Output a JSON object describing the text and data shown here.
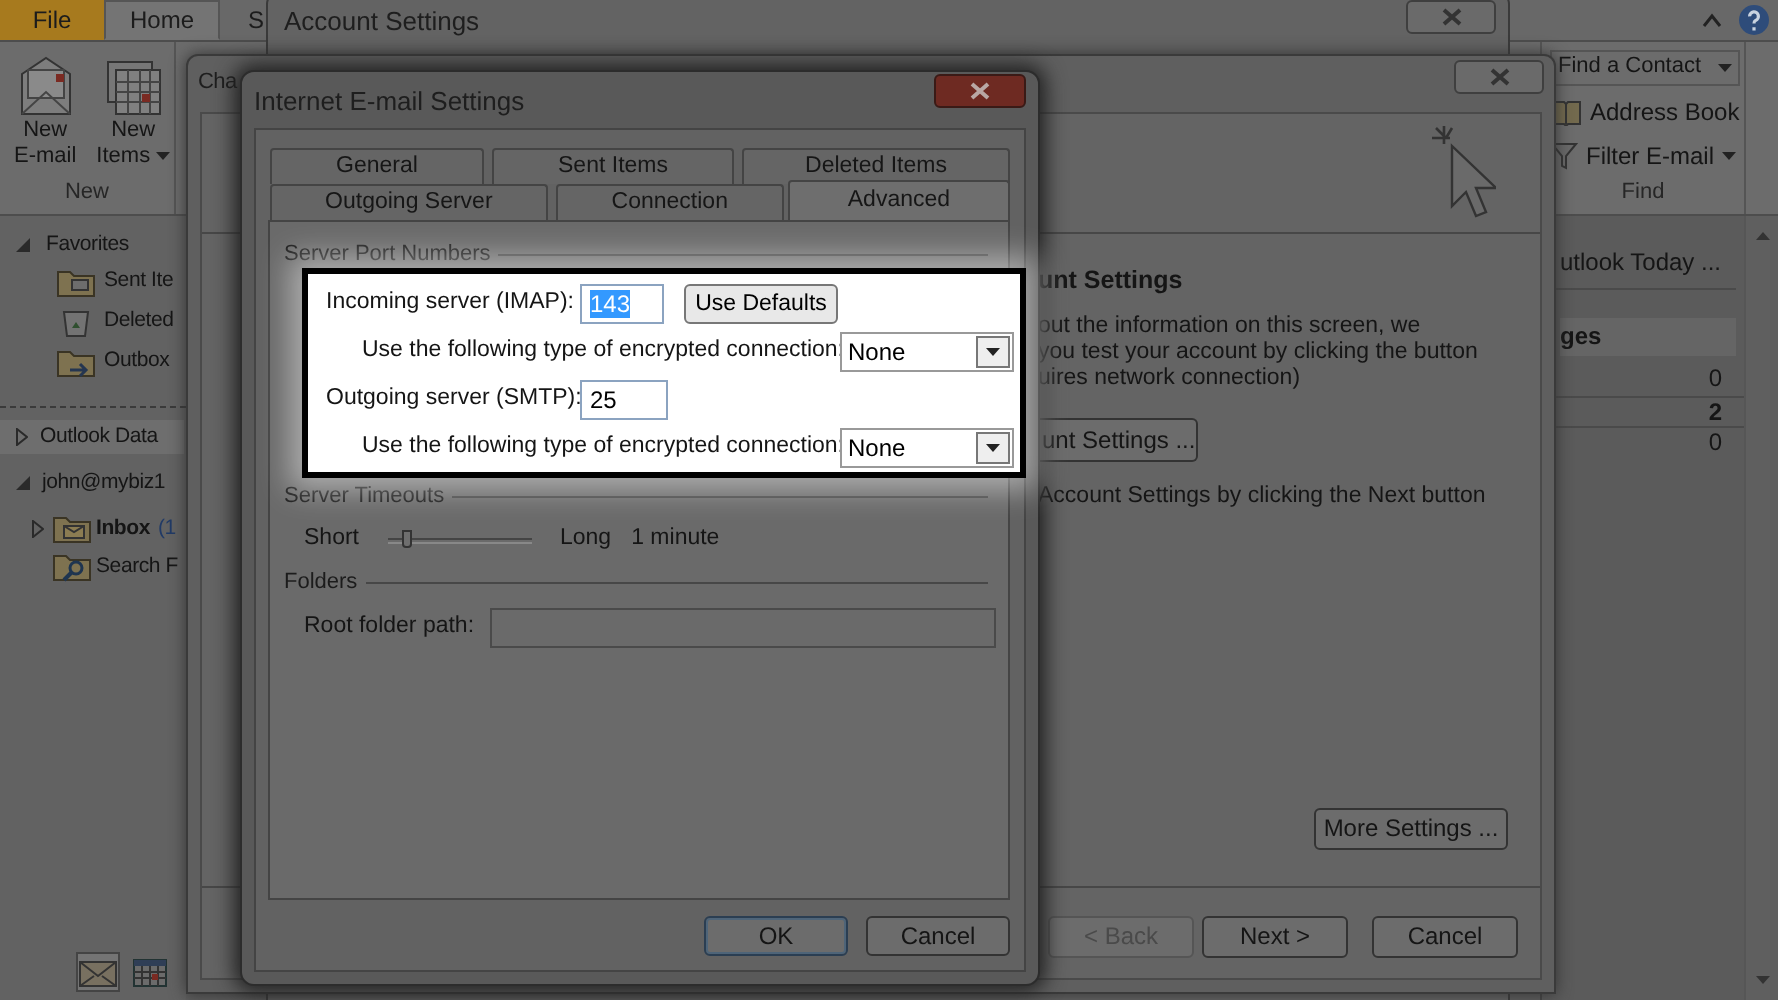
{
  "outlook": {
    "ribbon_tabs": [
      {
        "label": "File",
        "kind": "file",
        "selected": false
      },
      {
        "label": "Home",
        "kind": "tab",
        "selected": true
      },
      {
        "label": "S",
        "kind": "tab",
        "selected": false
      }
    ],
    "new_group": {
      "title": "New",
      "buttons": [
        {
          "label": "New E-mail",
          "kind": "mail",
          "dropdown": false
        },
        {
          "label": "New Items",
          "kind": "items",
          "dropdown": true
        }
      ]
    },
    "find_group": {
      "title": "Find",
      "items": [
        {
          "label": "Find a Contact",
          "kind": "search-box",
          "dropdown": true
        },
        {
          "label": "Address Book",
          "kind": "book",
          "dropdown": false
        },
        {
          "label": "Filter E-mail",
          "kind": "filter",
          "dropdown": true
        }
      ]
    },
    "navigation": {
      "favorites": {
        "label": "Favorites",
        "expanded": true,
        "children": [
          {
            "label": "Sent Ite",
            "kind": "sent"
          },
          {
            "label": "Deleted",
            "kind": "deleted"
          },
          {
            "label": "Outbox",
            "kind": "outbox"
          }
        ]
      },
      "accounts": [
        {
          "label": "Outlook Data",
          "expanded": false,
          "selected": true
        },
        {
          "label": "john@mybiz1",
          "expanded": true,
          "selected": false,
          "children": [
            {
              "label": "Inbox",
              "count": "(1",
              "kind": "inbox",
              "unread": true
            },
            {
              "label": "Search F",
              "kind": "search",
              "unread": false
            }
          ]
        }
      ],
      "bottom_icons": [
        {
          "kind": "mail",
          "selected": true
        },
        {
          "kind": "calendar",
          "selected": false
        }
      ]
    },
    "todo_bar": {
      "link": "utlook Today ...",
      "header": "ges",
      "counts": [
        {
          "value": "0",
          "bold": false
        },
        {
          "value": "2",
          "bold": true
        },
        {
          "value": "0",
          "bold": false
        }
      ]
    }
  },
  "account_settings": {
    "title": "Account Settings"
  },
  "change_account": {
    "title": "Cha",
    "heading": "unt Settings",
    "description": [
      "out the information on this screen, we",
      "you test your account by clicking the button",
      "uires network connection)"
    ],
    "test_button": "unt Settings ...",
    "next_hint": "Account Settings by clicking the Next button",
    "more_settings": "More Settings ...",
    "buttons": [
      {
        "label": "< Back",
        "disabled": true
      },
      {
        "label": "Next >",
        "disabled": false
      },
      {
        "label": "Cancel",
        "disabled": false
      }
    ]
  },
  "email_settings": {
    "title": "Internet E-mail Settings",
    "tab_rows": [
      [
        {
          "label": "General",
          "selected": false
        },
        {
          "label": "Sent Items",
          "selected": false
        },
        {
          "label": "Deleted Items",
          "selected": false
        }
      ],
      [
        {
          "label": "Outgoing Server",
          "selected": false
        },
        {
          "label": "Connection",
          "selected": false
        },
        {
          "label": "Advanced",
          "selected": true
        }
      ]
    ],
    "server_ports": {
      "title": "Server Port Numbers",
      "highlighted": true,
      "incoming": {
        "label": "Incoming server (IMAP):",
        "value": "143",
        "text_selected": true
      },
      "use_defaults": "Use Defaults",
      "incoming_encryption": {
        "label": "Use the following type of encrypted connection:",
        "value": "None"
      },
      "outgoing": {
        "label": "Outgoing server (SMTP):",
        "value": "25",
        "text_selected": false
      },
      "outgoing_encryption": {
        "label": "Use the following type of encrypted connection:",
        "value": "None"
      }
    },
    "timeouts": {
      "title": "Server Timeouts",
      "min_label": "Short",
      "max_label": "Long",
      "level": 0.1,
      "reading": "1 minute"
    },
    "folders": {
      "title": "Folders",
      "root_label": "Root folder path:"
    },
    "buttons": [
      {
        "label": "OK",
        "default": true
      },
      {
        "label": "Cancel",
        "default": false
      }
    ]
  }
}
